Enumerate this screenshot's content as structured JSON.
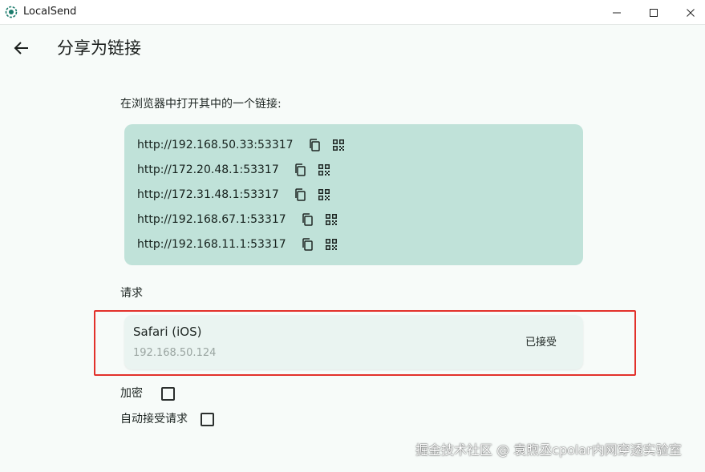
{
  "window": {
    "title": "LocalSend"
  },
  "header": {
    "title": "分享为链接"
  },
  "content": {
    "instruction": "在浏览器中打开其中的一个链接:",
    "links": [
      "http://192.168.50.33:53317",
      "http://172.20.48.1:53317",
      "http://172.31.48.1:53317",
      "http://192.168.67.1:53317",
      "http://192.168.11.1:53317"
    ],
    "requests_label": "请求",
    "request": {
      "device": "Safari (iOS)",
      "ip": "192.168.50.124",
      "status": "已接受"
    },
    "options": {
      "encrypt_label": "加密",
      "encrypt_checked": false,
      "auto_accept_label": "自动接受请求",
      "auto_accept_checked": false
    }
  },
  "watermark": "掘金技术社区 @ 袁煦丞cpolar内网穿透实验室",
  "colors": {
    "accent": "#1a7a6b",
    "link_card_bg": "#c0e2d9",
    "request_card_bg": "#eaf4f1",
    "highlight": "#e2312b"
  },
  "icons": {
    "logo": "localsend-logo-icon",
    "back": "arrow-left-icon",
    "copy": "copy-icon",
    "qr": "qr-code-icon"
  }
}
